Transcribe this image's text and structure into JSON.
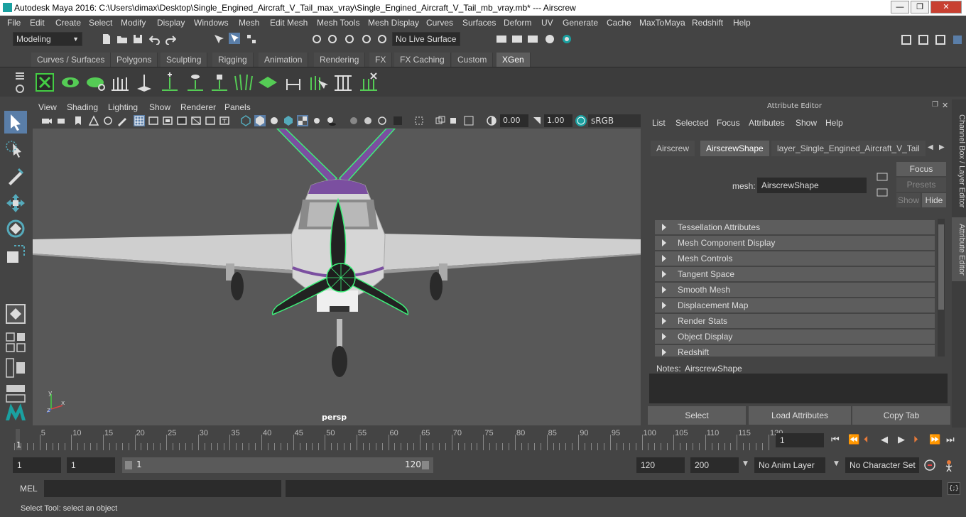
{
  "window": {
    "title": "Autodesk Maya 2016: C:\\Users\\dimax\\Desktop\\Single_Engined_Aircraft_V_Tail_max_vray\\Single_Engined_Aircraft_V_Tail_mb_vray.mb*   ---   Airscrew",
    "minimize": "—",
    "restore": "❐",
    "close": "✕"
  },
  "menubar": [
    "File",
    "Edit",
    "Create",
    "Select",
    "Modify",
    "Display",
    "Windows",
    "Mesh",
    "Edit Mesh",
    "Mesh Tools",
    "Mesh Display",
    "Curves",
    "Surfaces",
    "Deform",
    "UV",
    "Generate",
    "Cache",
    "MaxToMaya",
    "Redshift",
    "Help"
  ],
  "statusline": {
    "mode": "Modeling",
    "live_surface": "No Live Surface"
  },
  "shelf_tabs": [
    "Curves / Surfaces",
    "Polygons",
    "Sculpting",
    "Rigging",
    "Animation",
    "Rendering",
    "FX",
    "FX Caching",
    "Custom",
    "XGen"
  ],
  "shelf_active": "XGen",
  "viewport": {
    "menu": [
      "View",
      "Shading",
      "Lighting",
      "Show",
      "Renderer",
      "Panels"
    ],
    "exposure": "0.00",
    "gamma": "1.00",
    "colorspace": "sRGB gamma",
    "camera_label": "persp",
    "axis_x": "x",
    "axis_y": "y",
    "axis_z": "z"
  },
  "attribute_editor": {
    "title": "Attribute Editor",
    "menu": [
      "List",
      "Selected",
      "Focus",
      "Attributes",
      "Show",
      "Help"
    ],
    "tabs": [
      "Airscrew",
      "AirscrewShape",
      "layer_Single_Engined_Aircraft_V_Tail"
    ],
    "active_tab": "AirscrewShape",
    "mesh_label": "mesh:",
    "mesh_value": "AirscrewShape",
    "focus": "Focus",
    "presets": "Presets",
    "show": "Show",
    "hide": "Hide",
    "sections": [
      "Tessellation Attributes",
      "Mesh Component Display",
      "Mesh Controls",
      "Tangent Space",
      "Smooth Mesh",
      "Displacement Map",
      "Render Stats",
      "Object Display",
      "Redshift"
    ],
    "notes_label": "Notes:",
    "notes_value": "AirscrewShape",
    "buttons": [
      "Select",
      "Load Attributes",
      "Copy Tab"
    ]
  },
  "side_tabs": [
    "Channel Box / Layer Editor",
    "Attribute Editor"
  ],
  "timeslider": {
    "ticks": [
      "5",
      "10",
      "15",
      "20",
      "25",
      "30",
      "35",
      "40",
      "45",
      "50",
      "55",
      "60",
      "65",
      "70",
      "75",
      "80",
      "85",
      "90",
      "95",
      "100",
      "105",
      "110",
      "115",
      "120"
    ],
    "current_marker": "1",
    "current_frame": "1"
  },
  "range": {
    "start": "1",
    "playback_start": "1",
    "slider_start": "1",
    "slider_end": "120",
    "playback_end": "120",
    "end": "200",
    "anim_layer": "No Anim Layer",
    "character_set": "No Character Set"
  },
  "cmdline": {
    "label": "MEL"
  },
  "helpline": "Select Tool: select an object",
  "colors": {
    "accent": "#1aa0a0",
    "wire": "#3ef07a",
    "purple": "#7b4fa0"
  }
}
